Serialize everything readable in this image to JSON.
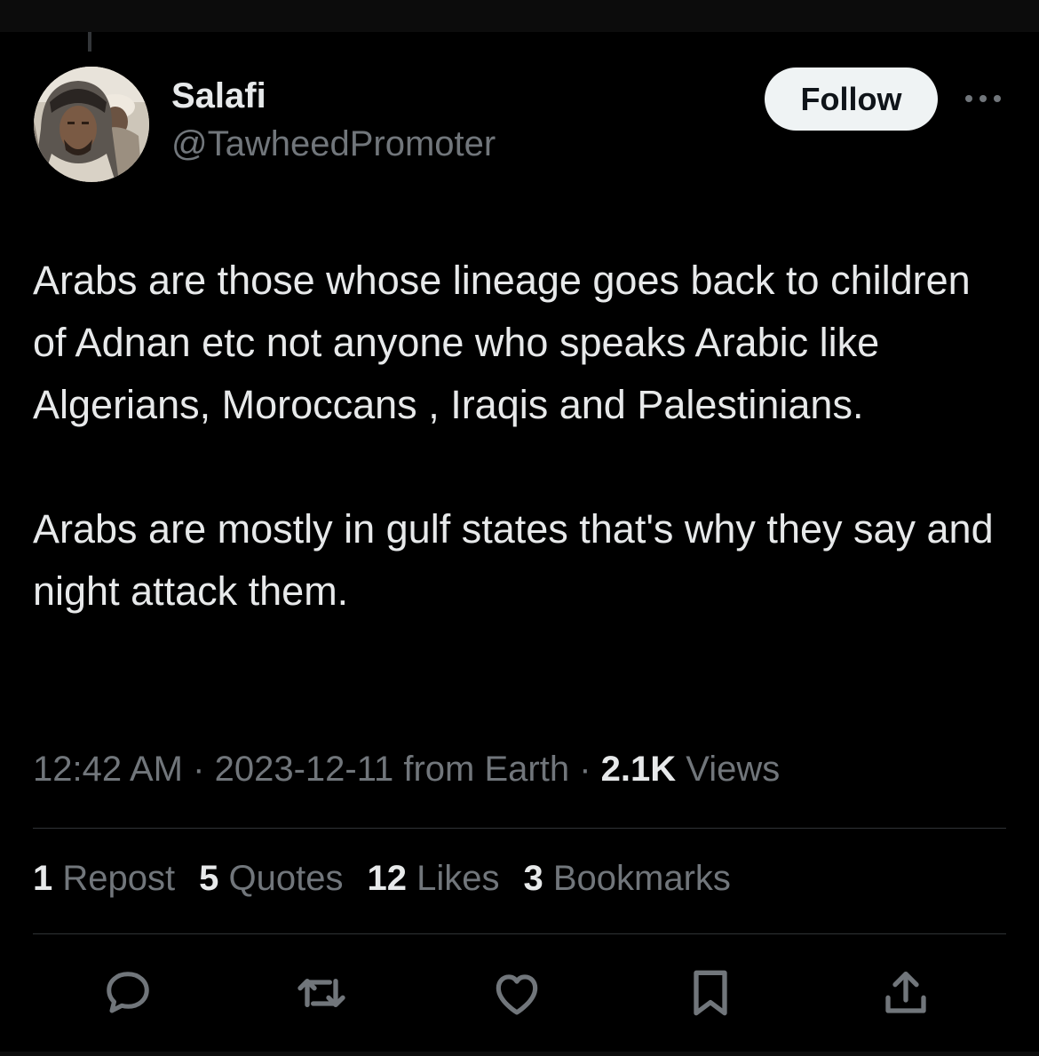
{
  "author": {
    "display_name": "Salafi",
    "handle": "@TawheedPromoter",
    "avatar_icon": "avatar-photo-icon"
  },
  "header": {
    "follow_label": "Follow",
    "more_icon": "more-options-icon"
  },
  "tweet": {
    "paragraphs": [
      "Arabs are those whose lineage goes back to children of Adnan etc not anyone who speaks Arabic like Algerians, Moroccans , Iraqis and Palestinians.",
      "Arabs are mostly in gulf states that's why they say and night attack them."
    ]
  },
  "meta": {
    "time": "12:42 AM",
    "separator": "·",
    "date": "2023-12-11",
    "source": "from Earth",
    "views_count": "2.1K",
    "views_label": "Views"
  },
  "stats": [
    {
      "count": "1",
      "label": "Repost"
    },
    {
      "count": "5",
      "label": "Quotes"
    },
    {
      "count": "12",
      "label": "Likes"
    },
    {
      "count": "3",
      "label": "Bookmarks"
    }
  ],
  "actions": [
    {
      "icon": "reply-icon"
    },
    {
      "icon": "repost-icon"
    },
    {
      "icon": "like-icon"
    },
    {
      "icon": "bookmark-icon"
    },
    {
      "icon": "share-icon"
    }
  ],
  "colors": {
    "background": "#000000",
    "primary_text": "#e7e9ea",
    "secondary_text": "#71767b",
    "divider": "#2f3336",
    "follow_bg": "#eff3f4"
  }
}
